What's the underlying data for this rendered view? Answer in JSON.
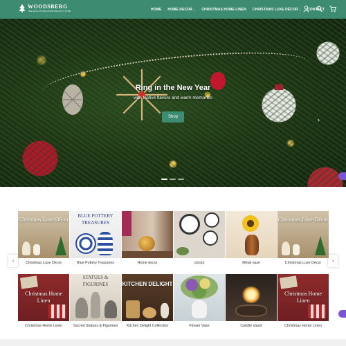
{
  "header": {
    "logo_name": "WOODSBERG",
    "logo_tagline": "THE EXCLUSIVE HOME DECOR STORE",
    "nav": [
      {
        "label": "HOME",
        "dropdown": false
      },
      {
        "label": "HOME DECOR",
        "dropdown": true
      },
      {
        "label": "CHRISTMAS HOME LINEN",
        "dropdown": false
      },
      {
        "label": "CHRISTMAS LUXE DÉCOR",
        "dropdown": true
      },
      {
        "label": "CONTACT",
        "dropdown": false
      }
    ],
    "caret": "⌄",
    "icons": [
      "user-icon",
      "search-icon",
      "cart-icon"
    ],
    "accent_color": "#3d8b70"
  },
  "hero": {
    "title": "Ring in the New Year",
    "subtitle": "with festive flavors and warm memories",
    "button_label": "Shop",
    "next_arrow": "›",
    "slide_count": 3,
    "active_slide": 1
  },
  "categories": {
    "prev_arrow": "‹",
    "next_arrow": "›",
    "row1": [
      {
        "label": "Christmas Luxe Décor",
        "overlay": "Christmas Luxe Décor"
      },
      {
        "label": "Blue Pottery Treasures",
        "overlay": "BLUE POTTERY TREASURES"
      },
      {
        "label": "Home decor",
        "overlay": ""
      },
      {
        "label": "clocks",
        "overlay": ""
      },
      {
        "label": "Metal vase",
        "overlay": ""
      },
      {
        "label": "Christmas Luxe Décor",
        "overlay": "Christmas Luxe Décor"
      }
    ],
    "row2": [
      {
        "label": "Christmas Home Linen",
        "overlay": "Christmas Home Linen"
      },
      {
        "label": "Sacred Statues & Figurines",
        "overlay": "STATUES & FIGURINES"
      },
      {
        "label": "Kitchen Delight Collection",
        "overlay": "KITCHEN DELIGHT"
      },
      {
        "label": "Flower Vase",
        "overlay": ""
      },
      {
        "label": "Candle stand",
        "overlay": ""
      },
      {
        "label": "Christmas Home Linen",
        "overlay": "Christmas Home Linen"
      }
    ]
  }
}
